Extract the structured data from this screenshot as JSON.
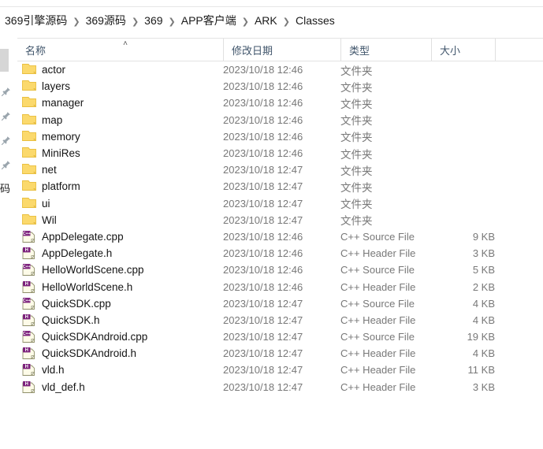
{
  "window": {
    "app": "windows-file-explorer"
  },
  "breadcrumb": {
    "separator": "❯",
    "items": [
      {
        "label": "369引擎源码"
      },
      {
        "label": "369源码"
      },
      {
        "label": "369"
      },
      {
        "label": "APP客户端"
      },
      {
        "label": "ARK"
      },
      {
        "label": "Classes"
      }
    ]
  },
  "columns": {
    "name": {
      "label": "名称",
      "sort": "˄"
    },
    "date": {
      "label": "修改日期"
    },
    "type": {
      "label": "类型"
    },
    "size": {
      "label": "大小"
    }
  },
  "navpane": {
    "pins": [
      "pin-icon",
      "pin-icon",
      "pin-icon",
      "pin-icon"
    ],
    "fragment": "码"
  },
  "colors": {
    "folder": "#fbd96c",
    "folder_edge": "#e9bf3f",
    "cpp_badge": "#7b1f7b",
    "header_text": "#40556b",
    "secondary_text": "#787878"
  },
  "rows": [
    {
      "icon": "folder-icon",
      "name": "actor",
      "date": "2023/10/18 12:46",
      "type": "文件夹",
      "type_cjk": true,
      "size": ""
    },
    {
      "icon": "folder-icon",
      "name": "layers",
      "date": "2023/10/18 12:46",
      "type": "文件夹",
      "type_cjk": true,
      "size": ""
    },
    {
      "icon": "folder-icon",
      "name": "manager",
      "date": "2023/10/18 12:46",
      "type": "文件夹",
      "type_cjk": true,
      "size": ""
    },
    {
      "icon": "folder-icon",
      "name": "map",
      "date": "2023/10/18 12:46",
      "type": "文件夹",
      "type_cjk": true,
      "size": ""
    },
    {
      "icon": "folder-icon",
      "name": "memory",
      "date": "2023/10/18 12:46",
      "type": "文件夹",
      "type_cjk": true,
      "size": ""
    },
    {
      "icon": "folder-icon",
      "name": "MiniRes",
      "date": "2023/10/18 12:46",
      "type": "文件夹",
      "type_cjk": true,
      "size": ""
    },
    {
      "icon": "folder-icon",
      "name": "net",
      "date": "2023/10/18 12:47",
      "type": "文件夹",
      "type_cjk": true,
      "size": ""
    },
    {
      "icon": "folder-icon",
      "name": "platform",
      "date": "2023/10/18 12:47",
      "type": "文件夹",
      "type_cjk": true,
      "size": ""
    },
    {
      "icon": "folder-icon",
      "name": "ui",
      "date": "2023/10/18 12:47",
      "type": "文件夹",
      "type_cjk": true,
      "size": ""
    },
    {
      "icon": "folder-icon",
      "name": "Wil",
      "date": "2023/10/18 12:47",
      "type": "文件夹",
      "type_cjk": true,
      "size": ""
    },
    {
      "icon": "cpp-source-icon",
      "name": "AppDelegate.cpp",
      "date": "2023/10/18 12:46",
      "type": "C++ Source File",
      "type_cjk": false,
      "size": "9 KB"
    },
    {
      "icon": "cpp-header-icon",
      "name": "AppDelegate.h",
      "date": "2023/10/18 12:46",
      "type": "C++ Header File",
      "type_cjk": false,
      "size": "3 KB"
    },
    {
      "icon": "cpp-source-icon",
      "name": "HelloWorldScene.cpp",
      "date": "2023/10/18 12:46",
      "type": "C++ Source File",
      "type_cjk": false,
      "size": "5 KB"
    },
    {
      "icon": "cpp-header-icon",
      "name": "HelloWorldScene.h",
      "date": "2023/10/18 12:46",
      "type": "C++ Header File",
      "type_cjk": false,
      "size": "2 KB"
    },
    {
      "icon": "cpp-source-icon",
      "name": "QuickSDK.cpp",
      "date": "2023/10/18 12:47",
      "type": "C++ Source File",
      "type_cjk": false,
      "size": "4 KB"
    },
    {
      "icon": "cpp-header-icon",
      "name": "QuickSDK.h",
      "date": "2023/10/18 12:47",
      "type": "C++ Header File",
      "type_cjk": false,
      "size": "4 KB"
    },
    {
      "icon": "cpp-source-icon",
      "name": "QuickSDKAndroid.cpp",
      "date": "2023/10/18 12:47",
      "type": "C++ Source File",
      "type_cjk": false,
      "size": "19 KB"
    },
    {
      "icon": "cpp-header-icon",
      "name": "QuickSDKAndroid.h",
      "date": "2023/10/18 12:47",
      "type": "C++ Header File",
      "type_cjk": false,
      "size": "4 KB"
    },
    {
      "icon": "cpp-header-icon",
      "name": "vld.h",
      "date": "2023/10/18 12:47",
      "type": "C++ Header File",
      "type_cjk": false,
      "size": "11 KB"
    },
    {
      "icon": "cpp-header-icon",
      "name": "vld_def.h",
      "date": "2023/10/18 12:47",
      "type": "C++ Header File",
      "type_cjk": false,
      "size": "3 KB"
    }
  ]
}
